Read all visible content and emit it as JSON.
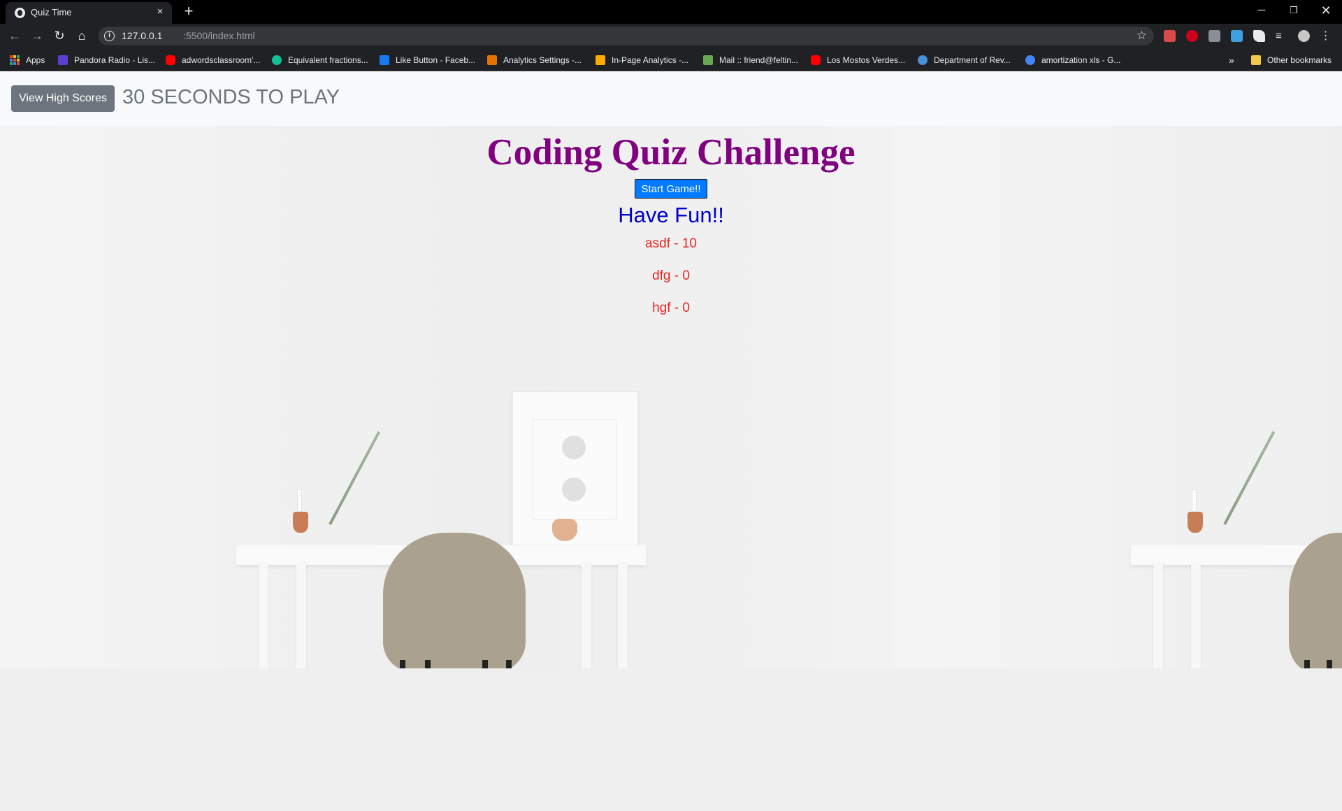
{
  "browser": {
    "tab_title": "Quiz Time",
    "tab_close": "×",
    "new_tab": "+",
    "url_host": "127.0.0.1",
    "url_path": ":5500/index.html",
    "bookmarks": [
      {
        "label": "Apps",
        "icon": "apps-grid-icon"
      },
      {
        "label": "Pandora Radio - Lis...",
        "icon": "pandora-icon",
        "color": "#5a3fd1"
      },
      {
        "label": "adwordsclassroom'...",
        "icon": "youtube-icon",
        "color": "#ff0000"
      },
      {
        "label": "Equivalent fractions...",
        "icon": "khan-academy-icon",
        "color": "#14bf96"
      },
      {
        "label": "Like Button - Faceb...",
        "icon": "facebook-icon",
        "color": "#1877f2"
      },
      {
        "label": "Analytics Settings -...",
        "icon": "analytics-icon",
        "color": "#e37400"
      },
      {
        "label": "In-Page Analytics -...",
        "icon": "bar-chart-icon",
        "color": "#f9ab00"
      },
      {
        "label": "Mail :: friend@feltin...",
        "icon": "mail-icon",
        "color": "#6aa84f"
      },
      {
        "label": "Los Mostos Verdes...",
        "icon": "youtube-icon",
        "color": "#ff0000"
      },
      {
        "label": "Department of Rev...",
        "icon": "globe-icon",
        "color": "#4a90d9"
      },
      {
        "label": "amortization xls - G...",
        "icon": "google-icon",
        "color": "#4285f4"
      }
    ],
    "overflow": "»",
    "other_bookmarks": "Other bookmarks"
  },
  "page": {
    "high_scores_button": "View High Scores",
    "timer_text": "30 SECONDS TO PLAY",
    "title": "Coding Quiz Challenge",
    "start_button": "Start Game!!",
    "subtitle": "Have Fun!!",
    "scores": [
      "asdf - 10",
      "dfg - 0",
      "hgf - 0"
    ]
  },
  "colors": {
    "title": "#800080",
    "subtitle": "#0000cd",
    "scores": "#e8261f",
    "start_button": "#007bff",
    "high_scores_button": "#6c757d"
  }
}
